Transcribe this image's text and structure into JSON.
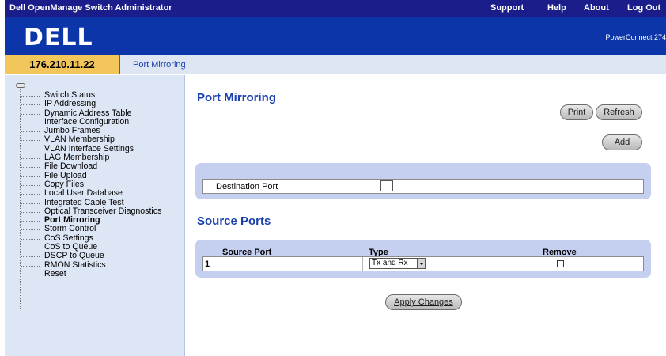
{
  "header": {
    "app_title": "Dell OpenManage Switch Administrator",
    "nav": [
      "Support",
      "Help",
      "About",
      "Log Out"
    ],
    "logo": "DELL",
    "model": "PowerConnect 274"
  },
  "ip_tab": "176.210.11.22",
  "breadcrumb": "Port Mirroring",
  "sidebar": {
    "items": [
      "Switch Status",
      "IP Addressing",
      "Dynamic Address Table",
      "Interface Configuration",
      "Jumbo Frames",
      "VLAN Membership",
      "VLAN Interface Settings",
      "LAG Membership",
      "File Download",
      "File Upload",
      "Copy Files",
      "Local User Database",
      "Integrated Cable Test",
      "Optical Transceiver Diagnostics",
      "Port Mirroring",
      "Storm Control",
      "CoS Settings",
      "CoS to Queue",
      "DSCP to Queue",
      "RMON Statistics",
      "Reset"
    ],
    "active": "Port Mirroring"
  },
  "main": {
    "title": "Port Mirroring",
    "buttons": {
      "print": "Print",
      "refresh": "Refresh",
      "add": "Add",
      "apply": "Apply Changes"
    },
    "destination": {
      "label": "Destination Port",
      "value": ""
    },
    "source": {
      "title": "Source Ports",
      "columns": [
        "Source Port",
        "Type",
        "Remove"
      ],
      "rows": [
        {
          "index": "1",
          "port": "",
          "type": "Tx and Rx",
          "remove": false
        }
      ]
    }
  }
}
